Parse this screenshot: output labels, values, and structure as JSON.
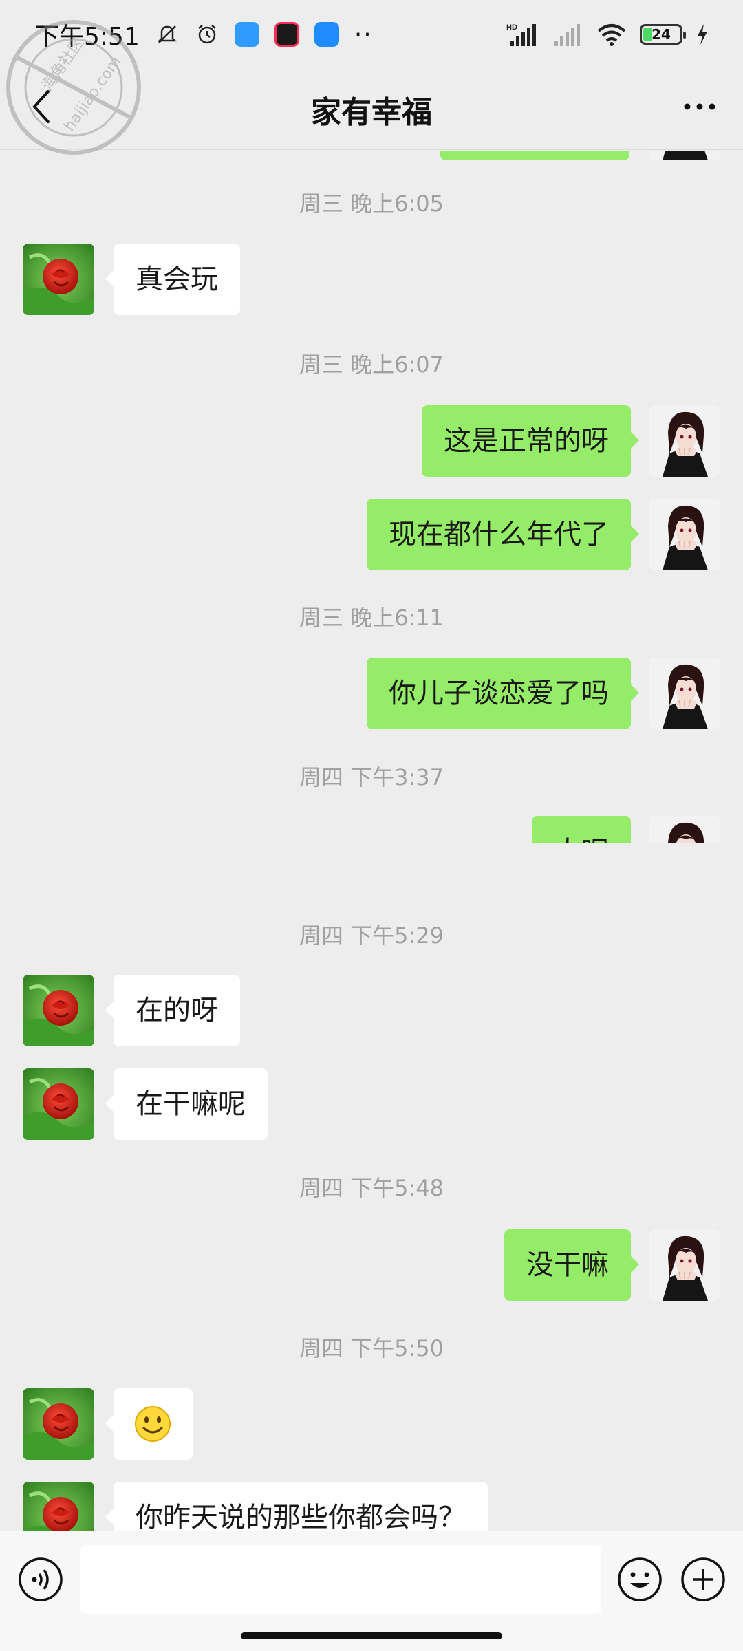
{
  "status_bar": {
    "time": "下午5:51",
    "battery_level": "24",
    "icons": [
      "mute-icon",
      "alarm-icon",
      "cloud-app-icon",
      "video-app-icon",
      "chat-app-icon",
      "more-dots-icon",
      "hd-signal-icon",
      "signal-icon",
      "wifi-icon",
      "battery-icon",
      "charging-icon"
    ]
  },
  "header": {
    "title": "家有幸福",
    "back_icon": "back-chevron-icon",
    "more_icon": "more-icon"
  },
  "watermark": {
    "text": "海角社区",
    "site": "haijiao.com"
  },
  "messages": [
    {
      "type": "time",
      "text": "周三 晚上6:05"
    },
    {
      "type": "msg",
      "side": "in",
      "text": "真会玩"
    },
    {
      "type": "time",
      "text": "周三 晚上6:07"
    },
    {
      "type": "msg",
      "side": "out",
      "text": "这是正常的呀"
    },
    {
      "type": "msg",
      "side": "out",
      "text": "现在都什么年代了"
    },
    {
      "type": "time",
      "text": "周三 晚上6:11"
    },
    {
      "type": "msg",
      "side": "out",
      "text": "你儿子谈恋爱了吗"
    },
    {
      "type": "time",
      "text": "周四 下午3:37"
    },
    {
      "type": "msg",
      "side": "out",
      "text": "人呢"
    },
    {
      "type": "time",
      "text": "周四 下午5:29"
    },
    {
      "type": "msg",
      "side": "in",
      "text": "在的呀"
    },
    {
      "type": "msg",
      "side": "in",
      "text": "在干嘛呢"
    },
    {
      "type": "time",
      "text": "周四 下午5:48"
    },
    {
      "type": "msg",
      "side": "out",
      "text": "没干嘛"
    },
    {
      "type": "time",
      "text": "周四 下午5:50"
    },
    {
      "type": "msg",
      "side": "in",
      "emoji": "smile-emoji"
    },
    {
      "type": "msg",
      "side": "in",
      "text": "你昨天说的那些你都会吗？"
    }
  ],
  "input_bar": {
    "voice_icon": "voice-icon",
    "emoji_icon": "emoji-icon",
    "plus_icon": "plus-icon",
    "input_value": ""
  },
  "colors": {
    "background": "#ededed",
    "out_bubble": "#95ec69",
    "in_bubble": "#ffffff",
    "timestamp": "#a0a0a0"
  }
}
